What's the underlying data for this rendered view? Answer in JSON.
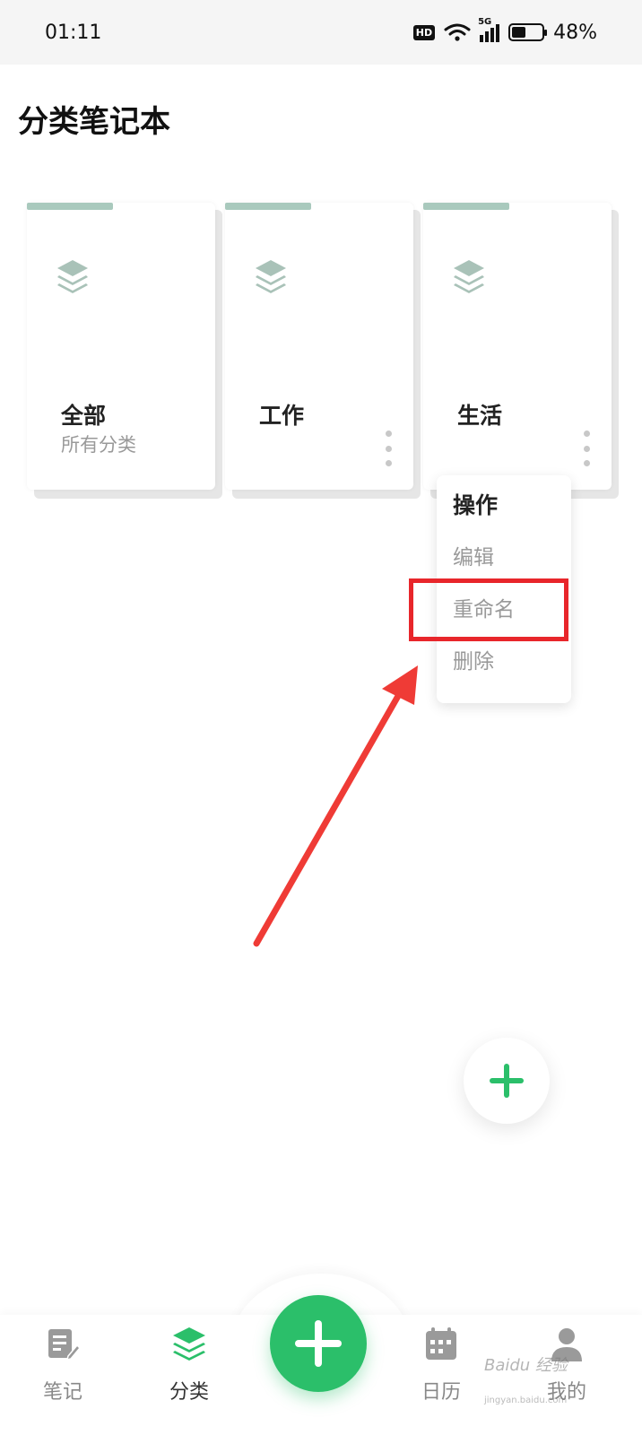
{
  "status_bar": {
    "time": "01:11",
    "hd_label": "HD",
    "network_label": "5G",
    "battery_text": "48%",
    "battery_level": 0.48
  },
  "header": {
    "title": "分类笔记本"
  },
  "categories": [
    {
      "name": "全部",
      "subtitle": "所有分类",
      "icon": "layers-icon",
      "has_more": false
    },
    {
      "name": "工作",
      "subtitle": "",
      "icon": "layers-icon",
      "has_more": true
    },
    {
      "name": "生活",
      "subtitle": "",
      "icon": "layers-icon",
      "has_more": true
    }
  ],
  "menu": {
    "title": "操作",
    "items": [
      "编辑",
      "重命名",
      "删除"
    ],
    "highlighted_item": "重命名"
  },
  "fab": {
    "icon": "plus-icon"
  },
  "bottom_nav": {
    "items": [
      {
        "label": "笔记",
        "icon": "note-edit-icon",
        "active": false
      },
      {
        "label": "分类",
        "icon": "layers-icon",
        "active": true
      },
      {
        "label": "日历",
        "icon": "calendar-icon",
        "active": false
      },
      {
        "label": "我的",
        "icon": "person-icon",
        "active": false
      }
    ],
    "center_icon": "plus-icon"
  },
  "watermark": {
    "text": "Baidu 经验",
    "sub": "jingyan.baidu.com"
  },
  "colors": {
    "accent_green": "#2bbf6a",
    "card_accent": "#a9c9bd",
    "icon_gray_green": "#a9c2b8",
    "highlight_red": "#e8262b"
  }
}
